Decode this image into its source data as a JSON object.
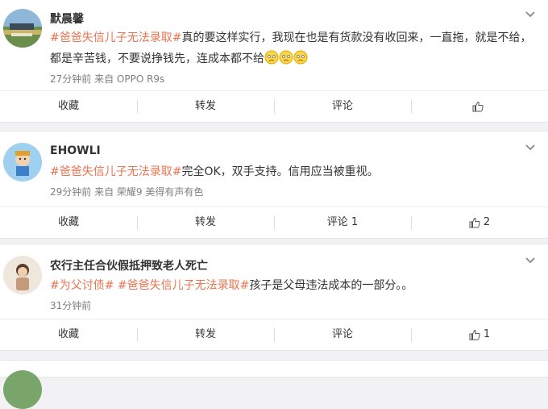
{
  "posts": [
    {
      "author": "默晨馨",
      "topic": "#爸爸失信儿子无法录取#",
      "text_line1": "真的要这样实行，我现在也是有货款没有收回来，一直拖，就是不给，",
      "text_line2": "都是辛苦钱，不要说挣钱先，连成本都不给",
      "emoji_count": 3,
      "meta": "27分钟前 来自 OPPO R9s",
      "actions": {
        "collect": "收藏",
        "forward": "转发",
        "comment": "评论",
        "like_count": ""
      }
    },
    {
      "author": "EHOWLI",
      "topic": "#爸爸失信儿子无法录取#",
      "text_line1": "完全OK，双手支持。信用应当被重视。",
      "meta": "29分钟前 来自 荣耀9 美得有声有色",
      "actions": {
        "collect": "收藏",
        "forward": "转发",
        "comment": "评论 1",
        "like_count": "2"
      }
    },
    {
      "author": "农行主任合伙假抵押致老人死亡",
      "topic1": "#为父讨债#",
      "topic2": "#爸爸失信儿子无法录取#",
      "text_line1": "孩子是父母违法成本的一部分。。",
      "meta": "31分钟前",
      "actions": {
        "collect": "收藏",
        "forward": "转发",
        "comment": "评论",
        "like_count": "1"
      }
    }
  ],
  "icons": {
    "menu": "chevron-down-icon",
    "like": "thumb-up-icon",
    "emoji": "sad-face-emoji-icon"
  },
  "colors": {
    "topic": "#eb7350",
    "meta": "#808080",
    "background": "#f2f2f5"
  }
}
